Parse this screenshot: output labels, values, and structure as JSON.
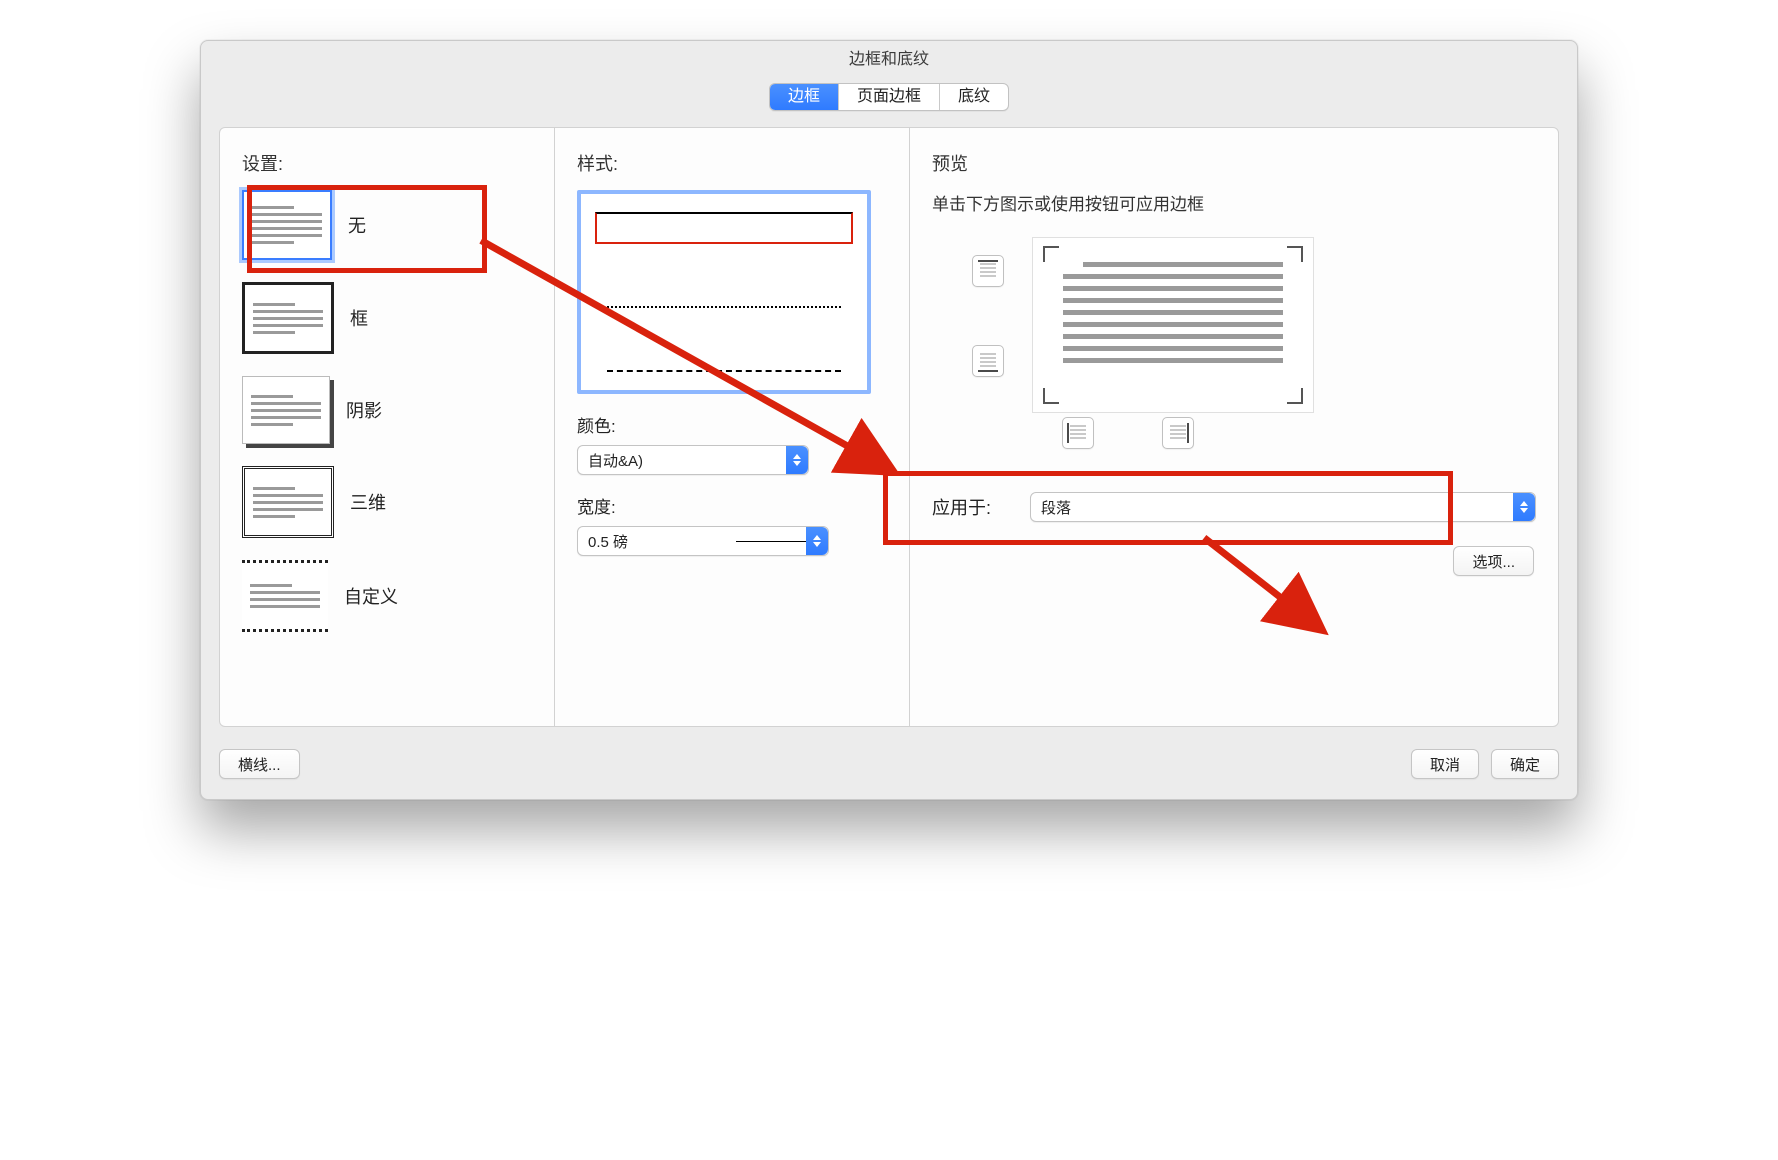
{
  "window": {
    "title": "边框和底纹"
  },
  "tabs": {
    "border": "边框",
    "page_border": "页面边框",
    "shading": "底纹"
  },
  "settings": {
    "label": "设置:",
    "options": {
      "none": "无",
      "box": "框",
      "shadow": "阴影",
      "three": "三维",
      "custom": "自定义"
    }
  },
  "style": {
    "label": "样式:",
    "color_label": "颜色:",
    "color_value": "自动&A)",
    "width_label": "宽度:",
    "width_value": "0.5 磅"
  },
  "preview": {
    "label": "预览",
    "hint": "单击下方图示或使用按钮可应用边框",
    "apply_label": "应用于:",
    "apply_value": "段落",
    "options_button": "选项..."
  },
  "buttons": {
    "hline": "横线...",
    "cancel": "取消",
    "ok": "确定"
  },
  "annotation_color": "#d9220d"
}
